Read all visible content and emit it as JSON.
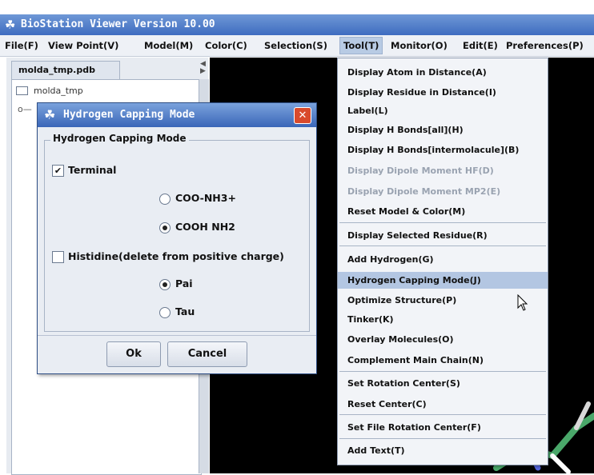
{
  "window": {
    "title": "BioStation Viewer Version 10.00",
    "app_icon": "molecule-app-icon"
  },
  "menubar": [
    {
      "label": "File(F)",
      "key": "F"
    },
    {
      "label": "View Point(V)",
      "key": "V"
    },
    {
      "label": "Model(M)",
      "key": "M"
    },
    {
      "label": "Color(C)",
      "key": "C"
    },
    {
      "label": "Selection(S)",
      "key": "S"
    },
    {
      "label": "Tool(T)",
      "key": "T",
      "active": true
    },
    {
      "label": "Monitor(O)",
      "key": "O"
    },
    {
      "label": "Edit(E)",
      "key": "E"
    },
    {
      "label": "Preferences(P)",
      "key": "P"
    }
  ],
  "left_panel": {
    "tab_label": "molda_tmp.pdb",
    "tree_root": "molda_tmp"
  },
  "dialog": {
    "title": "Hydrogen Capping Mode",
    "group_label": "Hydrogen Capping Mode",
    "terminal": {
      "label": "Terminal",
      "checked": true,
      "options": [
        {
          "label": "COO-NH3+",
          "selected": false
        },
        {
          "label": "COOH NH2",
          "selected": true
        }
      ]
    },
    "histidine": {
      "label": "Histidine(delete from positive charge)",
      "checked": false,
      "options": [
        {
          "label": "Pai",
          "selected": true
        },
        {
          "label": "Tau",
          "selected": false
        }
      ]
    },
    "ok_label": "Ok",
    "cancel_label": "Cancel"
  },
  "tool_menu": {
    "items": [
      {
        "label": "Display Atom in Distance(A)",
        "enabled": true
      },
      {
        "label": "Display Residue in Distance(I)",
        "enabled": true
      },
      {
        "label": "Label(L)",
        "enabled": true
      },
      {
        "label": "Display H Bonds[all](H)",
        "enabled": true
      },
      {
        "label": "Display H Bonds[intermolacule](B)",
        "enabled": true
      },
      {
        "label": "Display Dipole Moment HF(D)",
        "enabled": false
      },
      {
        "label": "Display Dipole Moment MP2(E)",
        "enabled": false
      },
      {
        "label": "Reset Model & Color(M)",
        "enabled": true
      },
      {
        "label": "Display Selected Residue(R)",
        "enabled": true
      },
      {
        "label": "Add Hydrogen(G)",
        "enabled": true
      },
      {
        "label": "Hydrogen Capping Mode(J)",
        "enabled": true,
        "highlighted": true
      },
      {
        "label": "Optimize Structure(P)",
        "enabled": true
      },
      {
        "label": "Tinker(K)",
        "enabled": true
      },
      {
        "label": "Overlay Molecules(O)",
        "enabled": true
      },
      {
        "label": "Complement Main Chain(N)",
        "enabled": true
      },
      {
        "label": "Set Rotation Center(S)",
        "enabled": true
      },
      {
        "label": "Reset Center(C)",
        "enabled": true
      },
      {
        "label": "Set File Rotation Center(F)",
        "enabled": true
      },
      {
        "label": "Add Text(T)",
        "enabled": true
      }
    ]
  },
  "colors": {
    "title_bar": "#3e6cc0",
    "menu_highlight": "#b3c6e2",
    "viewer_bg": "#000000",
    "close_button": "#d94a2c"
  }
}
